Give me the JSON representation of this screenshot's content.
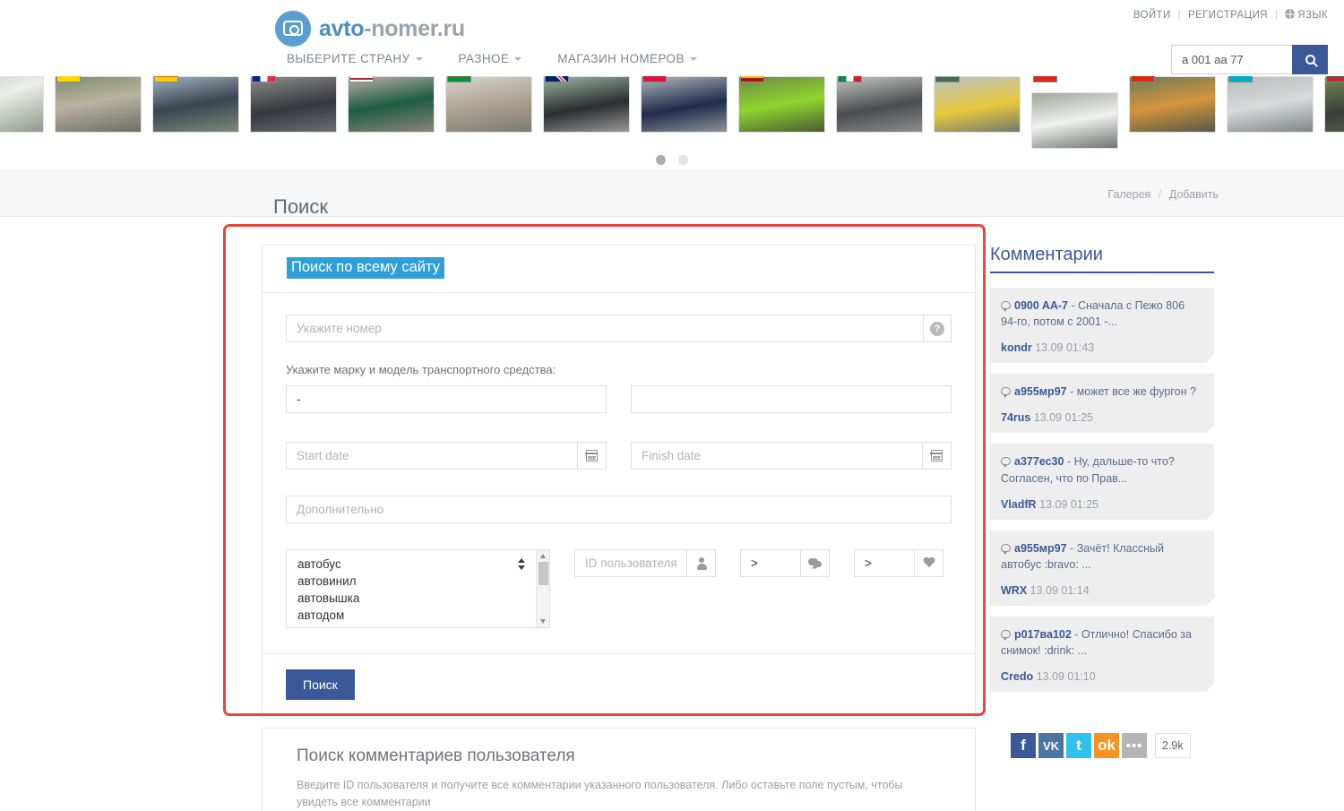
{
  "header": {
    "logo_text_blue": "avto",
    "logo_text_grey": "-nomer.ru",
    "logo_icon": "camera-icon",
    "nav": [
      {
        "label": "ВЫБЕРИТЕ СТРАНУ"
      },
      {
        "label": "РАЗНОЕ"
      },
      {
        "label": "МАГАЗИН НОМЕРОВ"
      }
    ],
    "login": "ВОЙТИ",
    "register": "РЕГИСТРАЦИЯ",
    "language": "ЯЗЫК",
    "separator": "|",
    "search_value": "а 001 аа 77",
    "search_icon": "magnifier-icon"
  },
  "carousel": {
    "slides": [
      {
        "flag": "ru",
        "car": "white-suv"
      },
      {
        "flag": "ua",
        "car": "silver-sedan"
      },
      {
        "flag": "de",
        "car": "dark-sedan"
      },
      {
        "flag": "fr",
        "car": "black-jaguar"
      },
      {
        "flag": "us",
        "car": "green-wagon"
      },
      {
        "flag": "by",
        "car": "beige-volvo"
      },
      {
        "flag": "gb",
        "car": "black-coupe"
      },
      {
        "flag": "pl",
        "car": "blue-golf"
      },
      {
        "flag": "es",
        "car": "green-challenger"
      },
      {
        "flag": "it",
        "car": "black-pickup"
      },
      {
        "flag": "hu",
        "car": "yellow-trabant"
      },
      {
        "flag": "ch",
        "car": "white-lamborghini"
      },
      {
        "flag": "cn",
        "car": "orange-lada"
      },
      {
        "flag": "kz",
        "car": "silver-tucson"
      },
      {
        "flag": "lt",
        "car": "dark-car"
      }
    ],
    "dots": [
      {
        "active": true
      },
      {
        "active": false
      }
    ]
  },
  "titlebar": {
    "title": "Поиск",
    "breadcrumb_gallery": "Галерея",
    "breadcrumb_separator": "/",
    "breadcrumb_add": "Добавить"
  },
  "search_form": {
    "tab_label": "Поиск по всему сайту",
    "number_placeholder": "Укажите номер",
    "help_icon": "question-mark-icon",
    "vehicle_label": "Укажите марку и модель транспортного средства:",
    "brand_value": "-",
    "model_value": "",
    "start_date_placeholder": "Start date",
    "finish_date_placeholder": "Finish date",
    "calendar_icon": "calendar-icon",
    "extra_placeholder": "Дополнительно",
    "category_options": [
      "автобус",
      "автовинил",
      "автовышка",
      "автодом"
    ],
    "user_id_placeholder": "ID пользователя",
    "user_icon": "user-icon",
    "comments_value": ">",
    "comments_icon": "comments-icon",
    "likes_value": ">",
    "likes_icon": "heart-icon",
    "submit_label": "Поиск"
  },
  "lower_section": {
    "title": "Поиск комментариев пользователя",
    "description": "Введите ID пользователя и получите все комментарии указанного пользователя. Либо оставьте поле пустым, чтобы увидеть все комментарии"
  },
  "sidebar": {
    "title": "Комментарии",
    "comments": [
      {
        "plate": "0900 AA-7",
        "dash": " - ",
        "text": "Сначала с Пежо 806 94-го, потом с 2001 -...",
        "author": "kondr",
        "time": "13.09 01:43"
      },
      {
        "plate": "а955мр97",
        "dash": " - ",
        "text": "может все же фургон ?",
        "author": "74rus",
        "time": "13.09 01:25"
      },
      {
        "plate": "а377ес30",
        "dash": " - ",
        "text": "Ну, дальше-то что? Согласен, что по Прав...",
        "author": "VladfR",
        "time": "13.09 01:25"
      },
      {
        "plate": "а955мр97",
        "dash": " - ",
        "text": "Зачёт! Классный автобус :bravo: ...",
        "author": "WRX",
        "time": "13.09 01:14"
      },
      {
        "plate": "р017ва102",
        "dash": " - ",
        "text": "Отлично! Спасибо за снимок! :drink: ...",
        "author": "Credo",
        "time": "13.09 01:10"
      }
    ]
  },
  "social": {
    "facebook": "f",
    "vk": "VK",
    "twitter": "t",
    "odnoklassniki": "ok",
    "more": "•••",
    "count": "2.9k"
  },
  "colors": {
    "brand_blue": "#3b5998",
    "tab_blue": "#2e9fd9",
    "annotation_red": "#e8453c"
  }
}
